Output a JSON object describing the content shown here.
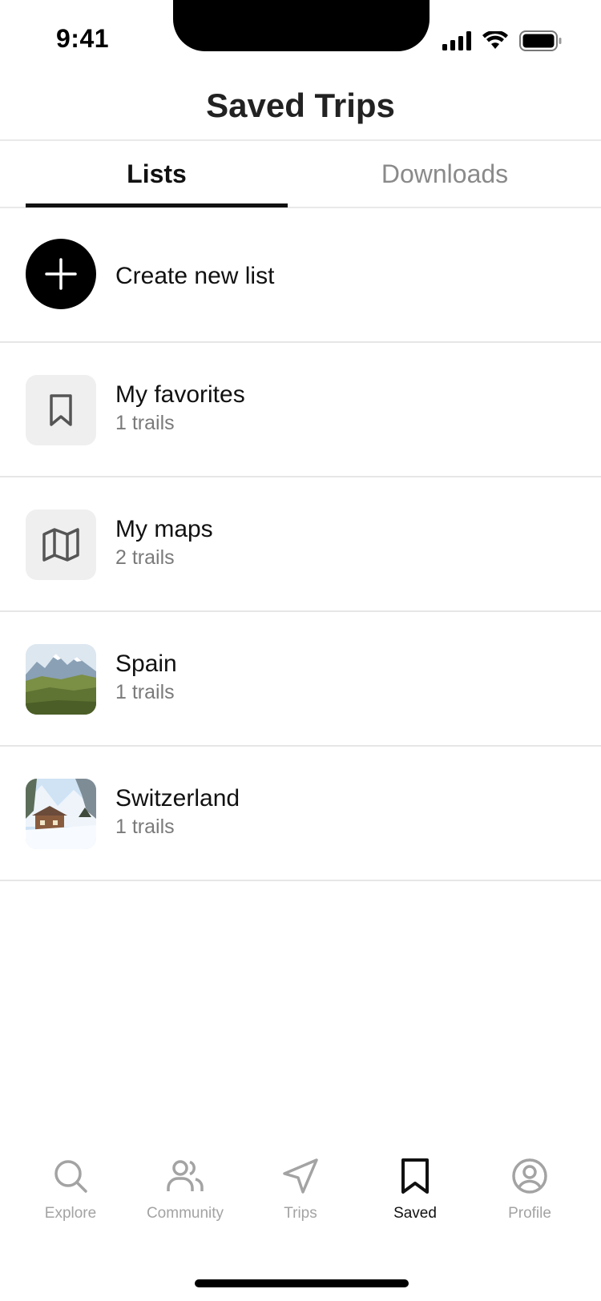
{
  "status_bar": {
    "time": "9:41"
  },
  "header": {
    "title": "Saved Trips"
  },
  "tabs": [
    {
      "label": "Lists",
      "active": true
    },
    {
      "label": "Downloads",
      "active": false
    }
  ],
  "create": {
    "label": "Create new list",
    "icon": "plus-icon"
  },
  "lists": [
    {
      "title": "My favorites",
      "subtitle": "1 trails",
      "icon": "bookmark-icon"
    },
    {
      "title": "My maps",
      "subtitle": "2 trails",
      "icon": "map-icon"
    },
    {
      "title": "Spain",
      "subtitle": "1 trails",
      "icon": "mountain-landscape-photo"
    },
    {
      "title": "Switzerland",
      "subtitle": "1 trails",
      "icon": "snowy-chalet-photo"
    }
  ],
  "bottom_nav": [
    {
      "label": "Explore",
      "icon": "search-icon",
      "active": false
    },
    {
      "label": "Community",
      "icon": "users-icon",
      "active": false
    },
    {
      "label": "Trips",
      "icon": "navigation-icon",
      "active": false
    },
    {
      "label": "Saved",
      "icon": "bookmark-icon",
      "active": true
    },
    {
      "label": "Profile",
      "icon": "profile-icon",
      "active": false
    }
  ],
  "colors": {
    "active": "#111111",
    "inactive": "#a3a3a3",
    "divider": "#e6e6e6"
  }
}
